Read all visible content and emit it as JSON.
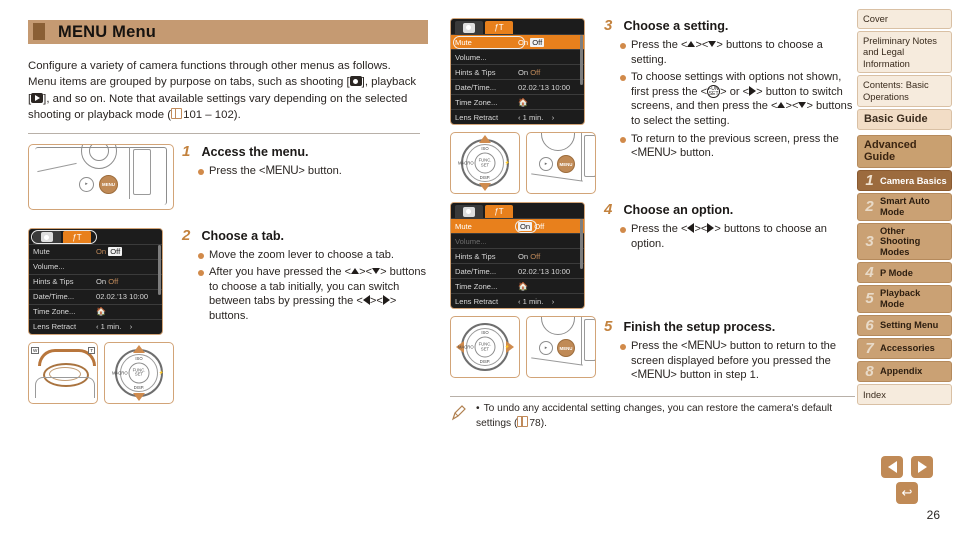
{
  "header": {
    "title": "MENU Menu"
  },
  "intro": {
    "part1": "Configure a variety of camera functions through other menus as follows. Menu items are grouped by purpose on tabs, such as shooting [",
    "part2": "], playback [",
    "part3": "], and so on. Note that available settings vary depending on the selected shooting or playback mode (",
    "ref": "101 – 102",
    "part4": ")."
  },
  "steps": [
    {
      "num": "1",
      "title": "Access the menu.",
      "bullets": [
        "Press the <MENU> button."
      ]
    },
    {
      "num": "2",
      "title": "Choose a tab.",
      "bullets": [
        "Move the zoom lever to choose a tab.",
        "After you have pressed the <▲><▼> buttons to choose a tab initially, you can switch between tabs by pressing the <◀><▶> buttons."
      ]
    },
    {
      "num": "3",
      "title": "Choose a setting.",
      "bullets": [
        "Press the <▲><▼> buttons to choose a setting.",
        "To choose settings with options not shown, first press the <FUNC. SET> or <▶> button to switch screens, and then press the <▲><▼> buttons to select the setting.",
        "To return to the previous screen, press the <MENU> button."
      ]
    },
    {
      "num": "4",
      "title": "Choose an option.",
      "bullets": [
        "Press the <◀><▶> buttons to choose an option."
      ]
    },
    {
      "num": "5",
      "title": "Finish the setup process.",
      "bullets": [
        "Press the <MENU> button to return to the screen displayed before you pressed the <MENU> button in step 1."
      ]
    }
  ],
  "menu_screen": {
    "tabs": [
      {
        "label": "📷",
        "active": false
      },
      {
        "label": "ƒT",
        "active": true
      }
    ],
    "rows": [
      {
        "label": "Mute",
        "value_on": "On",
        "value_off": "Off",
        "selected_value": "Off"
      },
      {
        "label": "Volume...",
        "value": ""
      },
      {
        "label": "Hints & Tips",
        "value_on": "On",
        "value_off": "Off",
        "selected_value": "On"
      },
      {
        "label": "Date/Time...",
        "value": "02.02.'13 10:00"
      },
      {
        "label": "Time Zone...",
        "value": "🏠"
      },
      {
        "label": "Lens Retract",
        "value": "1 min."
      }
    ]
  },
  "menu_screen_step4": {
    "rows": [
      {
        "label": "Mute",
        "value_on": "On",
        "value_off": "Off",
        "selected_value": "On"
      },
      {
        "label": "Volume...",
        "value": ""
      },
      {
        "label": "Hints & Tips",
        "value_on": "On",
        "value_off": "Off",
        "selected_value": "On"
      },
      {
        "label": "Date/Time...",
        "value": "02.02.'13 10:00"
      },
      {
        "label": "Time Zone...",
        "value": "🏠"
      },
      {
        "label": "Lens Retract",
        "value": "1 min."
      }
    ]
  },
  "figure_labels": {
    "menu_button": "MENU",
    "func_set": "FUNC. SET",
    "disp": "DISP.",
    "macro": "MACRO",
    "flash": "FLASH",
    "zoom_wide": "W",
    "zoom_tele": "T",
    "playback": "▶"
  },
  "note": {
    "bullet": "•",
    "text_before": "To undo any accidental setting changes, you can restore the camera's default settings (",
    "ref": "78",
    "text_after": ")."
  },
  "sidebar": {
    "items": [
      {
        "label": "Cover",
        "type": "plain"
      },
      {
        "label": "Preliminary Notes and Legal Information",
        "type": "plain"
      },
      {
        "label": "Contents: Basic Operations",
        "type": "plain"
      },
      {
        "label": "Basic Guide",
        "type": "big"
      },
      {
        "label": "Advanced Guide",
        "type": "adv"
      }
    ],
    "chapters": [
      {
        "num": "1",
        "label": "Camera Basics",
        "active": true
      },
      {
        "num": "2",
        "label": "Smart Auto Mode",
        "active": false
      },
      {
        "num": "3",
        "label": "Other Shooting Modes",
        "active": false
      },
      {
        "num": "4",
        "label": "P Mode",
        "active": false
      },
      {
        "num": "5",
        "label": "Playback Mode",
        "active": false
      },
      {
        "num": "6",
        "label": "Setting Menu",
        "active": false
      },
      {
        "num": "7",
        "label": "Accessories",
        "active": false
      },
      {
        "num": "8",
        "label": "Appendix",
        "active": false
      }
    ],
    "index": "Index"
  },
  "nav": {
    "prev": "◀",
    "next": "▶",
    "back": "↩",
    "page_number": "26"
  },
  "colors": {
    "accent": "#c08a56",
    "header_bg": "#c59a72",
    "header_mark": "#8a5f35",
    "step_num": "#c3823e",
    "bullet": "#d18a4a",
    "lcd_highlight": "#e8801c",
    "sidebar_active": "#9c6b3e"
  }
}
